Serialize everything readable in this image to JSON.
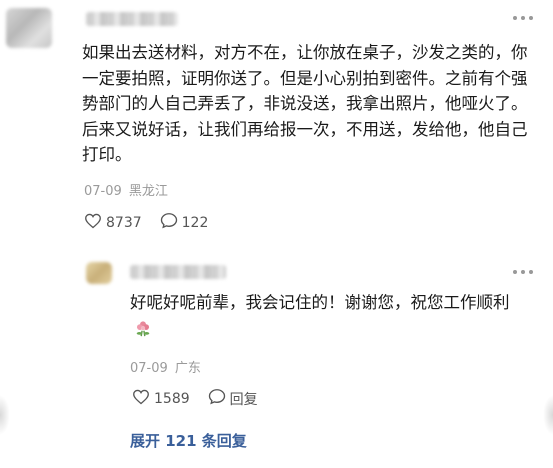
{
  "comment": {
    "text": "如果出去送材料，对方不在，让你放在桌子，沙发之类的，你一定要拍照，证明你送了。但是小心别拍到密件。之前有个强势部门的人自己弄丢了，非说没送，我拿出照片，他哑火了。后来又说好话，让我们再给报一次，不用送，发给他，他自己打印。",
    "date": "07-09",
    "location": "黑龙江",
    "likes": "8737",
    "comments": "122",
    "like_icon": "heart-outline-icon",
    "comment_icon": "chat-bubble-icon"
  },
  "reply": {
    "text": "好呢好呢前辈，我会记住的！谢谢您，祝您工作顺利",
    "emoji": "flower-emoji-icon",
    "date": "07-09",
    "location": "广东",
    "likes": "1589",
    "reply_label": "回复"
  },
  "expand_label": "展开 121 条回复",
  "more_icon": "more-dots-icon"
}
